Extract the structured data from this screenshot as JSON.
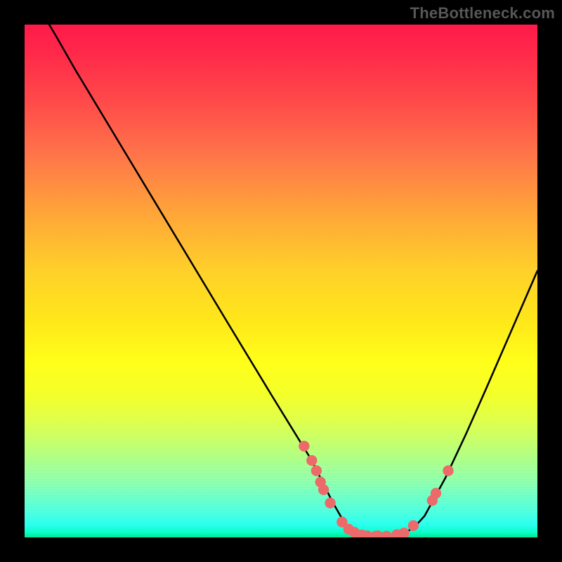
{
  "attribution": "TheBottleneck.com",
  "chart_data": {
    "type": "line",
    "title": "",
    "xlabel": "",
    "ylabel": "",
    "xlim": [
      0,
      100
    ],
    "ylim": [
      0,
      100
    ],
    "grid": false,
    "curve": [
      {
        "x": 4.8,
        "y": 100
      },
      {
        "x": 6,
        "y": 98
      },
      {
        "x": 10,
        "y": 91
      },
      {
        "x": 20,
        "y": 74.4
      },
      {
        "x": 30,
        "y": 57.8
      },
      {
        "x": 40,
        "y": 41.2
      },
      {
        "x": 48,
        "y": 28
      },
      {
        "x": 52,
        "y": 21.5
      },
      {
        "x": 56,
        "y": 15
      },
      {
        "x": 58,
        "y": 11
      },
      {
        "x": 60,
        "y": 7
      },
      {
        "x": 62,
        "y": 3.5
      },
      {
        "x": 63.5,
        "y": 1.6
      },
      {
        "x": 65,
        "y": 0.7
      },
      {
        "x": 68,
        "y": 0.2
      },
      {
        "x": 71,
        "y": 0.2
      },
      {
        "x": 74,
        "y": 0.8
      },
      {
        "x": 76,
        "y": 2
      },
      {
        "x": 78,
        "y": 4.2
      },
      {
        "x": 82,
        "y": 11.5
      },
      {
        "x": 86,
        "y": 20
      },
      {
        "x": 90,
        "y": 29
      },
      {
        "x": 95,
        "y": 40.5
      },
      {
        "x": 100,
        "y": 52
      }
    ],
    "points": [
      {
        "x": 54.5,
        "y": 17.8
      },
      {
        "x": 56.0,
        "y": 15.0
      },
      {
        "x": 56.9,
        "y": 13.0
      },
      {
        "x": 57.7,
        "y": 10.8
      },
      {
        "x": 58.3,
        "y": 9.3
      },
      {
        "x": 59.6,
        "y": 6.7
      },
      {
        "x": 61.9,
        "y": 3.0
      },
      {
        "x": 63.2,
        "y": 1.6
      },
      {
        "x": 64.3,
        "y": 1.0
      },
      {
        "x": 65.8,
        "y": 0.45
      },
      {
        "x": 66.8,
        "y": 0.3
      },
      {
        "x": 68.5,
        "y": 0.25
      },
      {
        "x": 68.9,
        "y": 0.3
      },
      {
        "x": 70.6,
        "y": 0.25
      },
      {
        "x": 72.6,
        "y": 0.55
      },
      {
        "x": 74.0,
        "y": 0.85
      },
      {
        "x": 75.8,
        "y": 2.3
      },
      {
        "x": 79.5,
        "y": 7.2
      },
      {
        "x": 80.2,
        "y": 8.6
      },
      {
        "x": 82.6,
        "y": 13.0
      }
    ],
    "marker_color": "#ec6a6a",
    "line_color": "#000000"
  }
}
